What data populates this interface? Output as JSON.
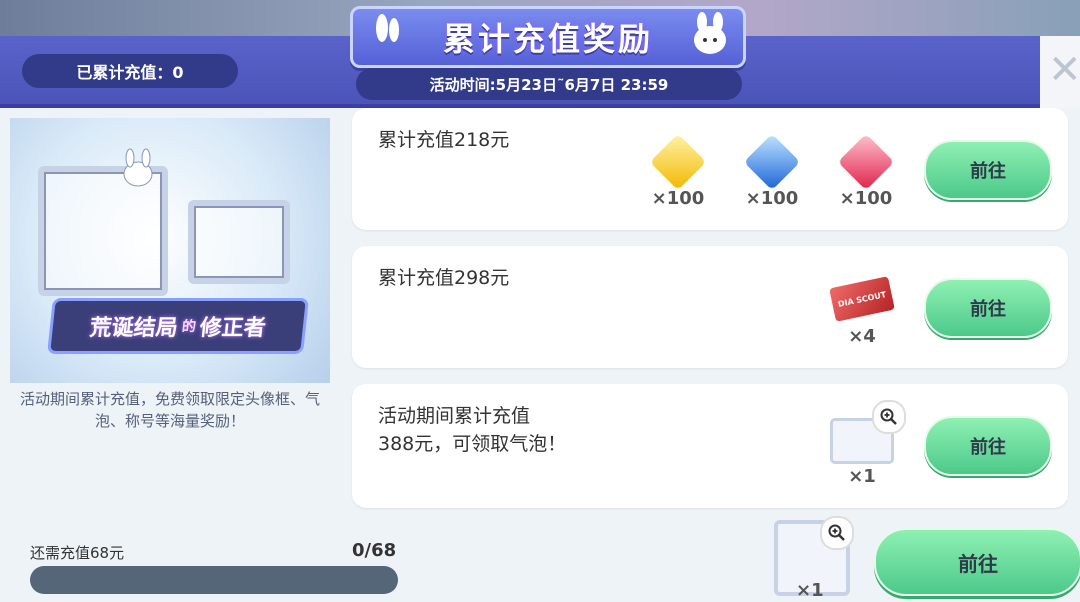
{
  "header": {
    "title": "累计充值奖励",
    "total_label": "已累计充值：0",
    "period": "活动时间:5月23日˜6月7日 23:59"
  },
  "left": {
    "promo_title_main": "荒诞结局",
    "promo_title_mid": "的",
    "promo_title_end": "修正者",
    "description": "活动期间累计充值，免费领取限定头像框、气泡、称号等海量奖励！"
  },
  "cards": [
    {
      "title": "累计充值218元",
      "items": [
        {
          "icon": "yellow-gem-icon",
          "qty": "×100"
        },
        {
          "icon": "blue-gem-icon",
          "qty": "×100"
        },
        {
          "icon": "red-gem-icon",
          "qty": "×100"
        }
      ],
      "button": "前往"
    },
    {
      "title": "累计充值298元",
      "items": [
        {
          "icon": "dia-scout-ticket-icon",
          "qty": "×4",
          "text": "DIA SCOUT"
        }
      ],
      "button": "前往"
    },
    {
      "title_line1": "活动期间累计充值",
      "title_line2": "388元，可领取气泡！",
      "items": [
        {
          "icon": "chat-bubble-frame-icon",
          "qty": "×1"
        }
      ],
      "button": "前往"
    }
  ],
  "bottom": {
    "label": "还需充值68元",
    "count": "0/68",
    "progress": 0,
    "item_qty": "×1",
    "button": "前往"
  },
  "colors": {
    "header": "#4b54b8",
    "button_green": "#4cc98a",
    "progress_track": "#556679"
  }
}
